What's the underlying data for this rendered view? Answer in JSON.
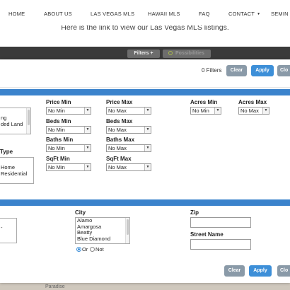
{
  "nav": {
    "items": [
      "HOME",
      "ABOUT US",
      "LAS VEGAS MLS",
      "HAWAII MLS",
      "FAQ",
      "CONTACT",
      "SEMIN"
    ],
    "intro_text": "Here is the link to view our Las Vegas MLS listings."
  },
  "background": {
    "filters_label": "Filters",
    "possibilities_label": "Possibilities",
    "map_label": "Paradise"
  },
  "modal": {
    "filter_count": "0 Filters",
    "clear_label": "Clear",
    "apply_label": "Apply",
    "close_label": "Clo",
    "property": {
      "type_list": [
        "ng",
        "ded Land"
      ],
      "subtype_label": "Type",
      "subtype_list": [
        "Home",
        "Residential"
      ]
    },
    "price_min": {
      "label": "Price Min",
      "value": "No Min"
    },
    "price_max": {
      "label": "Price Max",
      "value": "No Max"
    },
    "beds_min": {
      "label": "Beds Min",
      "value": "No Min"
    },
    "beds_max": {
      "label": "Beds Max",
      "value": "No Max"
    },
    "baths_min": {
      "label": "Baths Min",
      "value": "No Min"
    },
    "baths_max": {
      "label": "Baths Max",
      "value": "No Max"
    },
    "sqft_min": {
      "label": "SqFt Min",
      "value": "No Min"
    },
    "sqft_max": {
      "label": "SqFt Max",
      "value": "No Max"
    },
    "acres_min": {
      "label": "Acres Min",
      "value": "No Min"
    },
    "acres_max": {
      "label": "Acres Max",
      "value": "No Max"
    },
    "location": {
      "city_label": "City",
      "cities": [
        "Alamo",
        "Amargosa",
        "Beatty",
        "Blue Diamond"
      ],
      "or_label": "Or",
      "not_label": "Not",
      "zip_label": "Zip",
      "street_label": "Street Name",
      "left_fragment": "-"
    },
    "footer": {
      "clear_label": "Clear",
      "apply_label": "Apply",
      "close_label": "Clo"
    }
  },
  "colors": {
    "accent_blue": "#3b83cc",
    "apply_blue": "#3d8fd8",
    "clear_gray": "#8a9aa8"
  }
}
